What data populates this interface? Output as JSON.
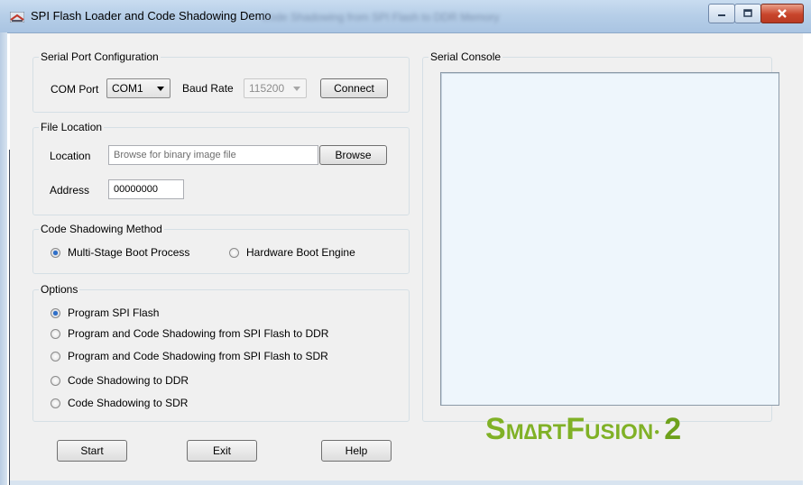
{
  "window": {
    "title": "SPI Flash Loader and Code Shadowing Demo",
    "title_suffix_blurred": "Code Shadowing from SPI Flash to DDR Memory"
  },
  "serial_port": {
    "group_label": "Serial Port Configuration",
    "com_port_label": "COM Port",
    "com_port_value": "COM1",
    "baud_rate_label": "Baud Rate",
    "baud_rate_value": "115200",
    "connect_label": "Connect"
  },
  "file_location": {
    "group_label": "File Location",
    "location_label": "Location",
    "location_placeholder": "Browse for binary image file",
    "browse_label": "Browse",
    "address_label": "Address",
    "address_value": "00000000"
  },
  "code_shadowing": {
    "group_label": "Code Shadowing Method",
    "options": [
      {
        "label": "Multi-Stage Boot Process",
        "selected": true
      },
      {
        "label": "Hardware Boot Engine",
        "selected": false
      }
    ]
  },
  "options": {
    "group_label": "Options",
    "items": [
      {
        "label": "Program SPI Flash",
        "selected": true
      },
      {
        "label": "Program and Code Shadowing from SPI Flash to DDR",
        "selected": false
      },
      {
        "label": "Program and Code Shadowing from SPI Flash to SDR",
        "selected": false
      },
      {
        "label": "Code Shadowing to DDR",
        "selected": false
      },
      {
        "label": "Code Shadowing to SDR",
        "selected": false
      }
    ]
  },
  "serial_console": {
    "group_label": "Serial Console"
  },
  "buttons": {
    "start": "Start",
    "exit": "Exit",
    "help": "Help"
  },
  "logo": {
    "part1_big": "S",
    "part1_small": "M",
    "symbol": "∆",
    "part2_small": "RT",
    "part3_big": "F",
    "part3_small": "USION",
    "version": "2"
  },
  "colors": {
    "logo_green": "#80b126",
    "titlebar": "#b7cfe8",
    "console_bg": "#eef6fc"
  }
}
